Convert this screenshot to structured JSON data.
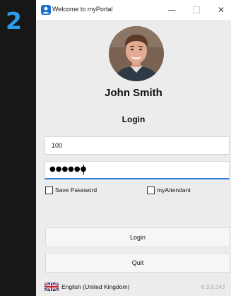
{
  "step_badge": "2",
  "window": {
    "title": "Welcome to myPortal",
    "icons": {
      "app": "myportal-app-icon",
      "minimize": "minimize-icon",
      "maximize": "maximize-icon",
      "close": "close-icon"
    },
    "minimize_glyph": "—",
    "close_glyph": "✕"
  },
  "profile": {
    "name": "John Smith",
    "avatar": "user-photo"
  },
  "login_heading": "Login",
  "form": {
    "username_value": "100",
    "password_mask": "●●●●●●",
    "save_password_label": "Save Password",
    "save_password_checked": false,
    "myattendant_label": "myAttendant",
    "myattendant_checked": false
  },
  "buttons": {
    "login_label": "Login",
    "quit_label": "Quit"
  },
  "footer": {
    "language_label": "English (United Kingdom)",
    "language_flag": "uk-flag-icon",
    "version": "6.3.0.143"
  },
  "colors": {
    "accent": "#2b7cd3",
    "step_badge": "#2b9dea",
    "window_bg": "#ececec",
    "page_bg": "#171717"
  }
}
